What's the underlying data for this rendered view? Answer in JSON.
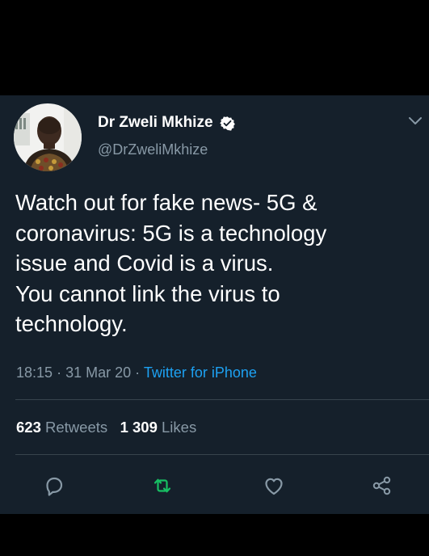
{
  "tweet": {
    "author_name": "Dr Zweli Mkhize",
    "author_handle": "@DrZweliMkhize",
    "text_lines": [
      "Watch out for fake news- 5G &",
      "coronavirus: 5G is a technology",
      "issue and Covid is a virus.",
      "You cannot link the virus to",
      "technology."
    ],
    "time": "18:15",
    "date": "31 Mar 20",
    "separator": "·",
    "source": "Twitter for iPhone",
    "retweets_count": "623",
    "retweets_label": "Retweets",
    "likes_count": "1 309",
    "likes_label": "Likes"
  },
  "icons": {
    "verified": "verified-badge-icon",
    "menu": "chevron-down-icon",
    "reply": "reply-icon",
    "retweet": "retweet-icon",
    "like": "heart-icon",
    "share": "share-icon"
  },
  "colors": {
    "background": "#15202b",
    "text": "#ffffff",
    "secondary_text": "#8899a6",
    "link": "#1da1f2",
    "retweet_green": "#17bf63",
    "divider": "#38444d"
  }
}
